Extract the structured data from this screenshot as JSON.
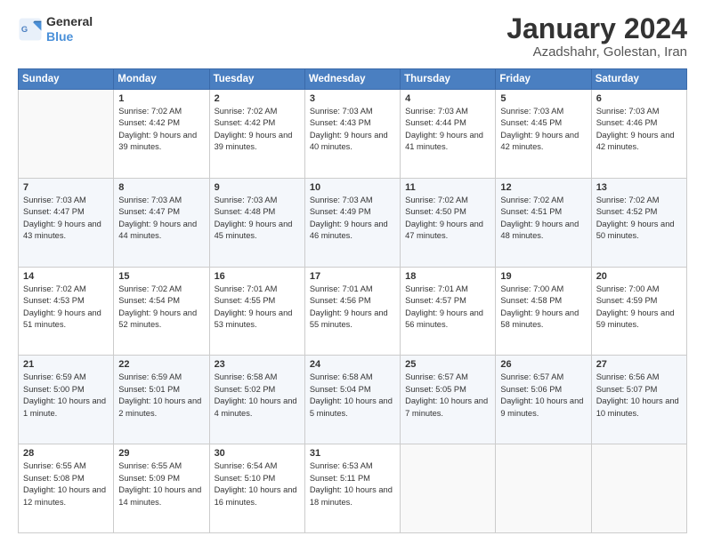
{
  "logo": {
    "line1": "General",
    "line2": "Blue"
  },
  "title": "January 2024",
  "subtitle": "Azadshahr, Golestan, Iran",
  "weekdays": [
    "Sunday",
    "Monday",
    "Tuesday",
    "Wednesday",
    "Thursday",
    "Friday",
    "Saturday"
  ],
  "weeks": [
    [
      {
        "day": "",
        "info": ""
      },
      {
        "day": "1",
        "info": "Sunrise: 7:02 AM\nSunset: 4:42 PM\nDaylight: 9 hours\nand 39 minutes."
      },
      {
        "day": "2",
        "info": "Sunrise: 7:02 AM\nSunset: 4:42 PM\nDaylight: 9 hours\nand 39 minutes."
      },
      {
        "day": "3",
        "info": "Sunrise: 7:03 AM\nSunset: 4:43 PM\nDaylight: 9 hours\nand 40 minutes."
      },
      {
        "day": "4",
        "info": "Sunrise: 7:03 AM\nSunset: 4:44 PM\nDaylight: 9 hours\nand 41 minutes."
      },
      {
        "day": "5",
        "info": "Sunrise: 7:03 AM\nSunset: 4:45 PM\nDaylight: 9 hours\nand 42 minutes."
      },
      {
        "day": "6",
        "info": "Sunrise: 7:03 AM\nSunset: 4:46 PM\nDaylight: 9 hours\nand 42 minutes."
      }
    ],
    [
      {
        "day": "7",
        "info": "Sunrise: 7:03 AM\nSunset: 4:47 PM\nDaylight: 9 hours\nand 43 minutes."
      },
      {
        "day": "8",
        "info": "Sunrise: 7:03 AM\nSunset: 4:47 PM\nDaylight: 9 hours\nand 44 minutes."
      },
      {
        "day": "9",
        "info": "Sunrise: 7:03 AM\nSunset: 4:48 PM\nDaylight: 9 hours\nand 45 minutes."
      },
      {
        "day": "10",
        "info": "Sunrise: 7:03 AM\nSunset: 4:49 PM\nDaylight: 9 hours\nand 46 minutes."
      },
      {
        "day": "11",
        "info": "Sunrise: 7:02 AM\nSunset: 4:50 PM\nDaylight: 9 hours\nand 47 minutes."
      },
      {
        "day": "12",
        "info": "Sunrise: 7:02 AM\nSunset: 4:51 PM\nDaylight: 9 hours\nand 48 minutes."
      },
      {
        "day": "13",
        "info": "Sunrise: 7:02 AM\nSunset: 4:52 PM\nDaylight: 9 hours\nand 50 minutes."
      }
    ],
    [
      {
        "day": "14",
        "info": "Sunrise: 7:02 AM\nSunset: 4:53 PM\nDaylight: 9 hours\nand 51 minutes."
      },
      {
        "day": "15",
        "info": "Sunrise: 7:02 AM\nSunset: 4:54 PM\nDaylight: 9 hours\nand 52 minutes."
      },
      {
        "day": "16",
        "info": "Sunrise: 7:01 AM\nSunset: 4:55 PM\nDaylight: 9 hours\nand 53 minutes."
      },
      {
        "day": "17",
        "info": "Sunrise: 7:01 AM\nSunset: 4:56 PM\nDaylight: 9 hours\nand 55 minutes."
      },
      {
        "day": "18",
        "info": "Sunrise: 7:01 AM\nSunset: 4:57 PM\nDaylight: 9 hours\nand 56 minutes."
      },
      {
        "day": "19",
        "info": "Sunrise: 7:00 AM\nSunset: 4:58 PM\nDaylight: 9 hours\nand 58 minutes."
      },
      {
        "day": "20",
        "info": "Sunrise: 7:00 AM\nSunset: 4:59 PM\nDaylight: 9 hours\nand 59 minutes."
      }
    ],
    [
      {
        "day": "21",
        "info": "Sunrise: 6:59 AM\nSunset: 5:00 PM\nDaylight: 10 hours\nand 1 minute."
      },
      {
        "day": "22",
        "info": "Sunrise: 6:59 AM\nSunset: 5:01 PM\nDaylight: 10 hours\nand 2 minutes."
      },
      {
        "day": "23",
        "info": "Sunrise: 6:58 AM\nSunset: 5:02 PM\nDaylight: 10 hours\nand 4 minutes."
      },
      {
        "day": "24",
        "info": "Sunrise: 6:58 AM\nSunset: 5:04 PM\nDaylight: 10 hours\nand 5 minutes."
      },
      {
        "day": "25",
        "info": "Sunrise: 6:57 AM\nSunset: 5:05 PM\nDaylight: 10 hours\nand 7 minutes."
      },
      {
        "day": "26",
        "info": "Sunrise: 6:57 AM\nSunset: 5:06 PM\nDaylight: 10 hours\nand 9 minutes."
      },
      {
        "day": "27",
        "info": "Sunrise: 6:56 AM\nSunset: 5:07 PM\nDaylight: 10 hours\nand 10 minutes."
      }
    ],
    [
      {
        "day": "28",
        "info": "Sunrise: 6:55 AM\nSunset: 5:08 PM\nDaylight: 10 hours\nand 12 minutes."
      },
      {
        "day": "29",
        "info": "Sunrise: 6:55 AM\nSunset: 5:09 PM\nDaylight: 10 hours\nand 14 minutes."
      },
      {
        "day": "30",
        "info": "Sunrise: 6:54 AM\nSunset: 5:10 PM\nDaylight: 10 hours\nand 16 minutes."
      },
      {
        "day": "31",
        "info": "Sunrise: 6:53 AM\nSunset: 5:11 PM\nDaylight: 10 hours\nand 18 minutes."
      },
      {
        "day": "",
        "info": ""
      },
      {
        "day": "",
        "info": ""
      },
      {
        "day": "",
        "info": ""
      }
    ]
  ]
}
